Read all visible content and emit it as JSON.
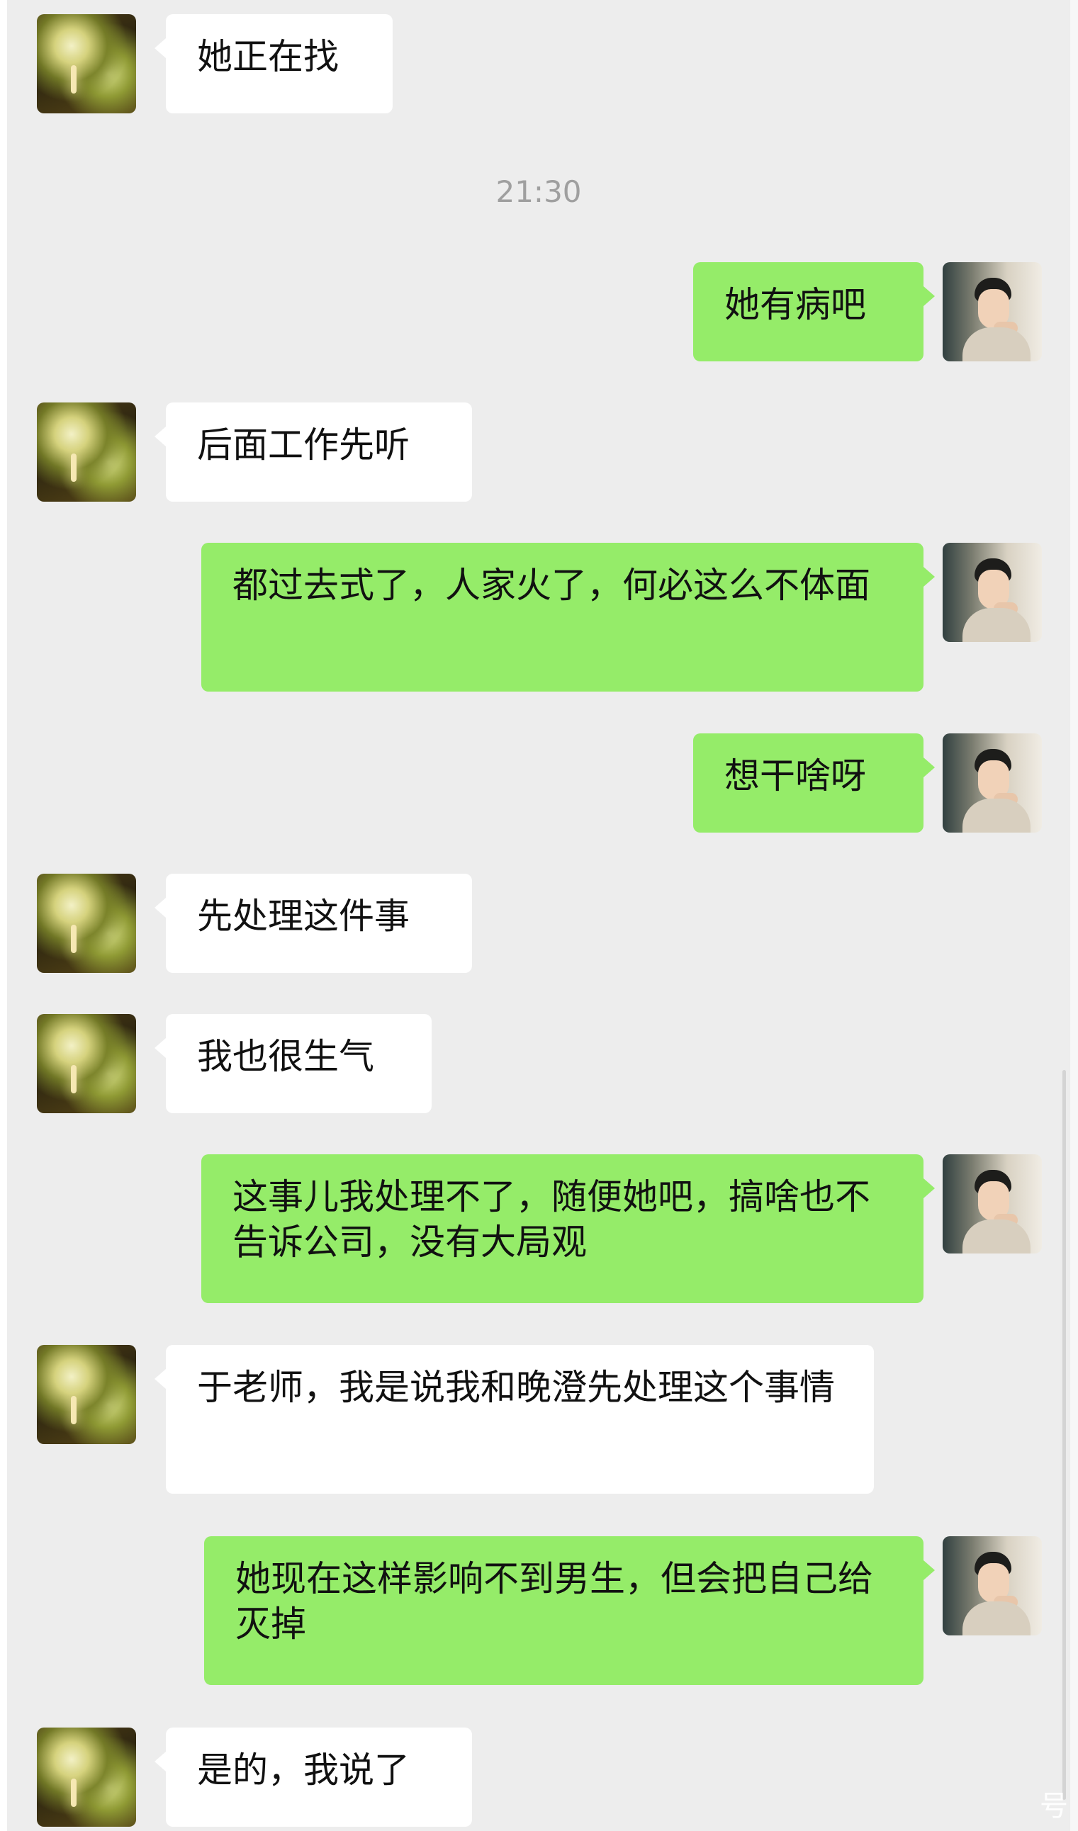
{
  "timestamp": "21:30",
  "watermark": "号",
  "messages": [
    {
      "side": "left",
      "text": "她正在找"
    },
    {
      "side": "right",
      "text": "她有病吧"
    },
    {
      "side": "left",
      "text": "后面工作先听"
    },
    {
      "side": "right",
      "text": "都过去式了，人家火了，何必这么不体面"
    },
    {
      "side": "right",
      "text": "想干啥呀"
    },
    {
      "side": "left",
      "text": "先处理这件事"
    },
    {
      "side": "left",
      "text": "我也很生气"
    },
    {
      "side": "right",
      "text": "这事儿我处理不了，随便她吧，搞啥也不告诉公司，没有大局观"
    },
    {
      "side": "left",
      "text": "于老师，我是说我和晚澄先处理这个事情"
    },
    {
      "side": "right",
      "text": "她现在这样影响不到男生，但会把自己给灭掉"
    },
    {
      "side": "left",
      "text": "是的，我说了"
    }
  ]
}
